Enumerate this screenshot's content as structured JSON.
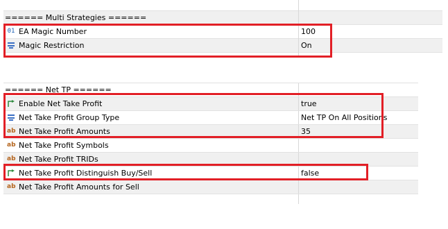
{
  "panel1": {
    "header": "====== Multi Strategies  ======",
    "rows": [
      {
        "icon": "numeric-icon",
        "name": "EA Magic Number",
        "value": "100"
      },
      {
        "icon": "enum-list-icon",
        "name": "Magic Restriction",
        "value": "On"
      }
    ]
  },
  "panel2": {
    "header": "====== Net TP ======",
    "rows": [
      {
        "icon": "boolean-arrow-icon",
        "name": "Enable Net Take Profit",
        "value": "true"
      },
      {
        "icon": "enum-list-icon",
        "name": "Net Take Profit Group Type",
        "value": "Net TP On All Positions"
      },
      {
        "icon": "string-ab-icon",
        "name": "Net Take Profit Amounts",
        "value": "35"
      },
      {
        "icon": "string-ab-icon",
        "name": "Net Take Profit Symbols",
        "value": ""
      },
      {
        "icon": "string-ab-icon",
        "name": "Net Take Profit TRIDs",
        "value": ""
      },
      {
        "icon": "boolean-arrow-icon",
        "name": "Net Take Profit Distinguish Buy/Sell",
        "value": "false"
      },
      {
        "icon": "string-ab-icon",
        "name": "Net Take Profit Amounts for Sell",
        "value": ""
      }
    ]
  },
  "icon_glyphs": {
    "numeric": "01",
    "string": "ab"
  },
  "colors": {
    "highlight": "#e21f26",
    "alt_row": "#f0f0f0",
    "numeric_icon": "#1a5fb4",
    "string_icon": "#b5651d",
    "bool_icon": "#2e8b3e",
    "enum_icon": "#3a6fc4"
  }
}
